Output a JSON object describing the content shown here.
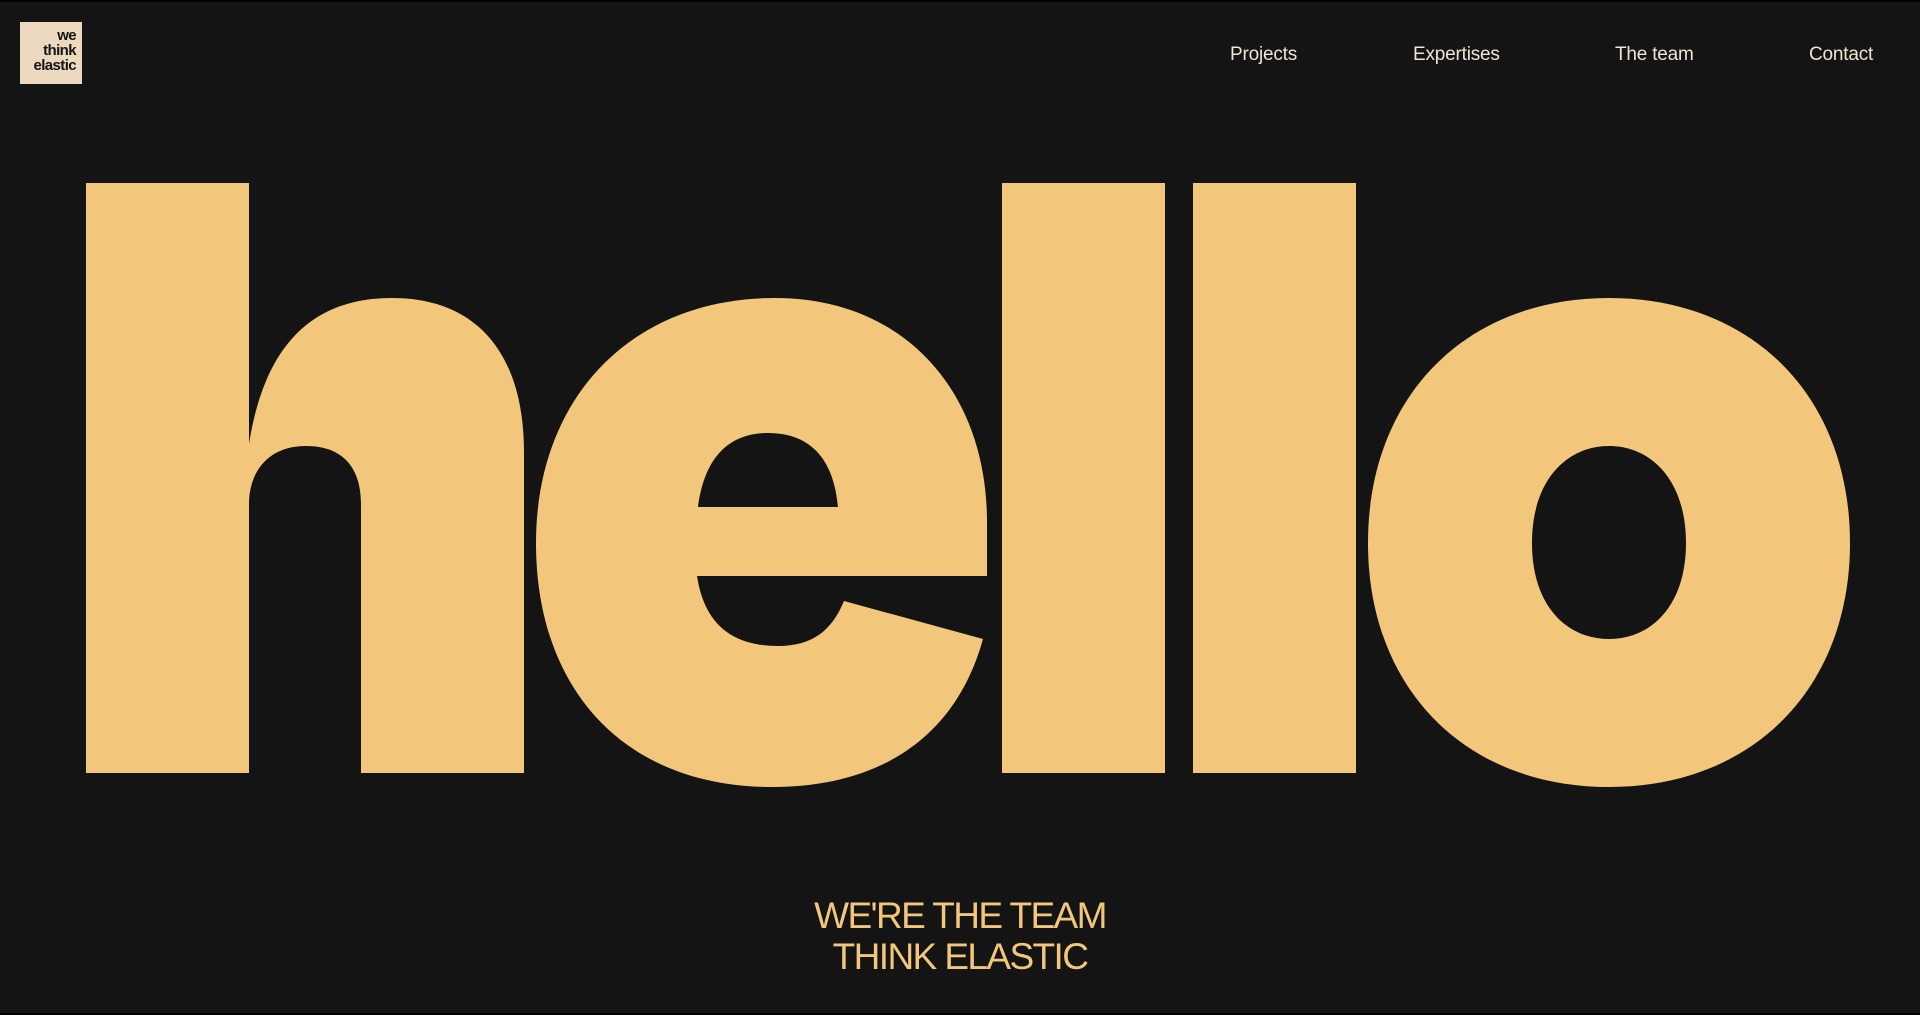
{
  "logo": {
    "lines": [
      "we",
      "think",
      "elastic"
    ]
  },
  "nav": {
    "items": [
      {
        "label": "Projects"
      },
      {
        "label": "Expertises"
      },
      {
        "label": "The team"
      },
      {
        "label": "Contact"
      }
    ]
  },
  "hero": {
    "word": "hello"
  },
  "tagline": {
    "line1": "WE'RE THE TEAM",
    "line2": "THINK ELASTIC"
  },
  "colors": {
    "background": "#141414",
    "accent": "#f2c77c",
    "logo_background": "#ecd9bf",
    "nav_text": "#f0e4d2"
  }
}
